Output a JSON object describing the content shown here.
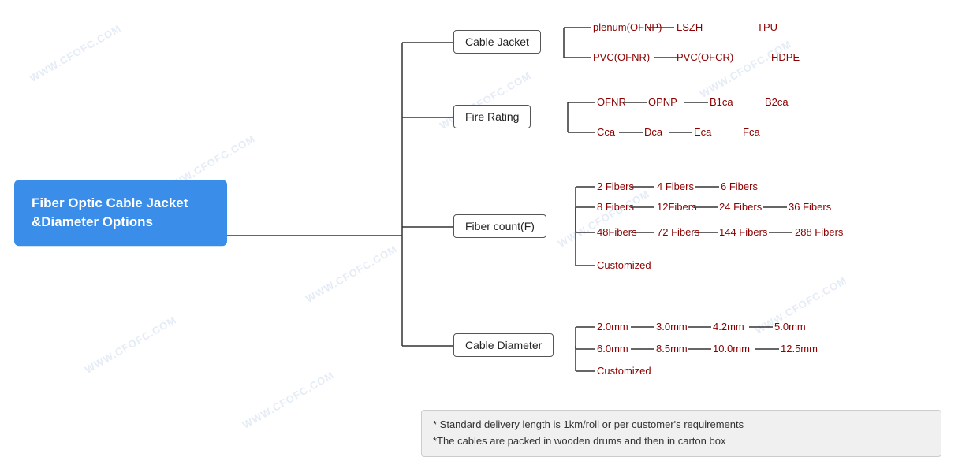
{
  "title": "Fiber Optic Cable Jacket &Diameter Options",
  "watermarks": [
    "WWW.CFOFC.COM"
  ],
  "nodes": {
    "cable_jacket": "Cable Jacket",
    "fire_rating": "Fire Rating",
    "fiber_count": "Fiber count(F)",
    "cable_diameter": "Cable Diameter"
  },
  "leaves": {
    "cable_jacket_row1": [
      "plenum(OFNP)",
      "LSZH",
      "TPU"
    ],
    "cable_jacket_row2": [
      "PVC(OFNR)",
      "PVC(OFCR)",
      "HDPE"
    ],
    "fire_rating_row1": [
      "OFNR",
      "OPNP",
      "B1ca",
      "B2ca"
    ],
    "fire_rating_row2": [
      "Cca",
      "Dca",
      "Eca",
      "Fca"
    ],
    "fiber_row1": [
      "2 Fibers",
      "4 Fibers",
      "6 Fibers"
    ],
    "fiber_row2": [
      "8 Fibers",
      "12Fibers",
      "24 Fibers",
      "36 Fibers"
    ],
    "fiber_row3": [
      "48Fibers",
      "72 Fibers",
      "144 Fibers",
      "288 Fibers"
    ],
    "fiber_row4": [
      "Customized"
    ],
    "diameter_row1": [
      "2.0mm",
      "3.0mm",
      "4.2mm",
      "5.0mm"
    ],
    "diameter_row2": [
      "6.0mm",
      "8.5mm",
      "10.0mm",
      "12.5mm"
    ],
    "diameter_row3": [
      "Customized"
    ]
  },
  "note": {
    "line1": "* Standard delivery length is 1km/roll or per customer's requirements",
    "line2": "*The cables are packed in wooden drums and then in carton box"
  },
  "colors": {
    "title_bg": "#3a8eea",
    "node_border": "#555",
    "leaf_color": "#8B0000",
    "note_bg": "#f0f0f0"
  }
}
